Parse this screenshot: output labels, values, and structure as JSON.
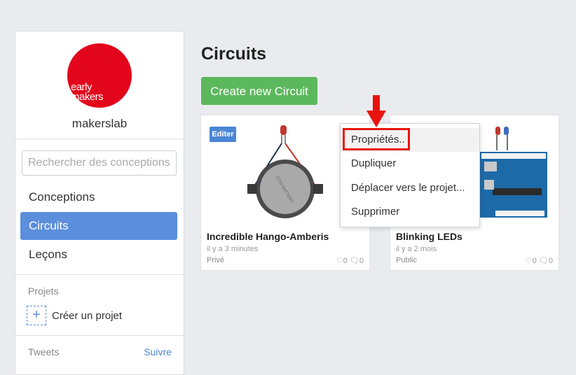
{
  "sidebar": {
    "logo_line1": "early",
    "logo_line2": "makers",
    "username": "makerslab",
    "search_placeholder": "Rechercher des conceptions",
    "nav": [
      {
        "label": "Conceptions"
      },
      {
        "label": "Circuits"
      },
      {
        "label": "Leçons"
      }
    ],
    "projects_label": "Projets",
    "create_project": "Créer un projet",
    "tweets_label": "Tweets",
    "follow_label": "Suivre"
  },
  "main": {
    "title": "Circuits",
    "create_button": "Create new Circuit",
    "cards": [
      {
        "edit_badge": "Editer",
        "name": "Incredible Hango-Amberis",
        "time": "il y a 3 minutes",
        "visibility": "Privé",
        "likes": "0",
        "comments": "0"
      },
      {
        "name": "Blinking LEDs",
        "time": "il y a 2 mois",
        "visibility": "Public",
        "likes": "0",
        "comments": "0"
      }
    ]
  },
  "context_menu": {
    "items": [
      "Propriétés..",
      "Dupliquer",
      "Déplacer vers le projet...",
      "Supprimer"
    ]
  },
  "colors": {
    "accent": "#5b8fdc",
    "create_button": "#5cb85c",
    "logo": "#e3051b",
    "annotation": "#e8130f"
  }
}
